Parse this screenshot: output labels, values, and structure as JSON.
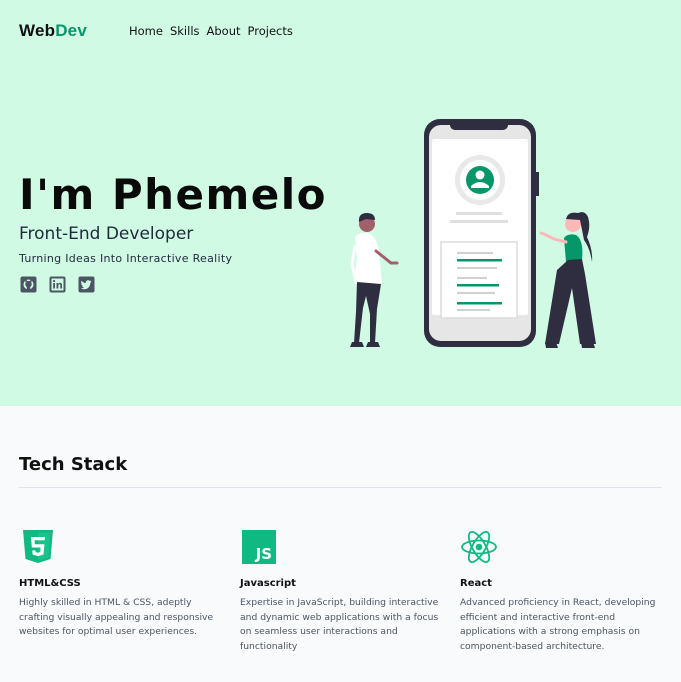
{
  "brand": {
    "part1": "Web",
    "part2": "Dev"
  },
  "nav": {
    "items": [
      "Home",
      "Skills",
      "About",
      "Projects"
    ]
  },
  "hero": {
    "name": "I'm Phemelo",
    "role": "Front-End Developer",
    "tagline": "Turning Ideas Into Interactive Reality",
    "socials": [
      "github-icon",
      "linkedin-icon",
      "twitter-icon"
    ]
  },
  "tech": {
    "title": "Tech Stack",
    "cards": [
      {
        "icon": "html5-icon",
        "title": "HTML&CSS",
        "desc": "Highly skilled in HTML & CSS, adeptly crafting visually appealing and responsive websites for optimal user experiences."
      },
      {
        "icon": "javascript-icon",
        "title": "Javascript",
        "desc": "Expertise in JavaScript, building interactive and dynamic web applications with a focus on seamless user interactions and functionality"
      },
      {
        "icon": "react-icon",
        "title": "React",
        "desc": "Advanced proficiency in React, developing efficient and interactive front-end applications with a strong emphasis on component-based architecture."
      }
    ]
  },
  "colors": {
    "hero_bg": "#d1fae5",
    "accent": "#059669",
    "section_bg": "#f8fafc",
    "text": "#111111"
  }
}
